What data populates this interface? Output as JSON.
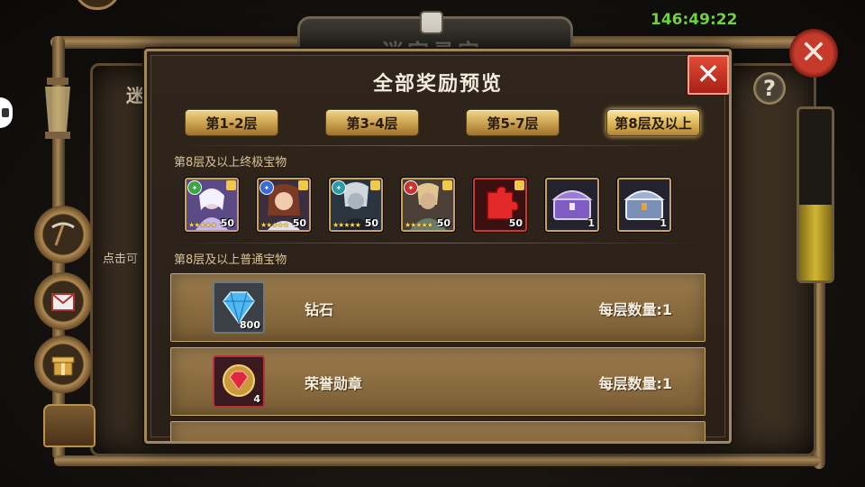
{
  "hud": {
    "timer": "146:49:22",
    "background_title": "迷宫寻宝",
    "side_hint": "点击可",
    "side_banner": "迷"
  },
  "modal": {
    "title": "全部奖励预览",
    "close_label": "✕",
    "tabs": [
      {
        "label": "第1-2层"
      },
      {
        "label": "第3-4层"
      },
      {
        "label": "第5-7层"
      },
      {
        "label": "第8层及以上",
        "active": true
      }
    ],
    "ultimate_section_label": "第8层及以上终极宝物",
    "ultimate_items": [
      {
        "name": "hero-shard-1",
        "count": "50",
        "stars": "★★★★★",
        "element_color": "#3aa545"
      },
      {
        "name": "hero-shard-2",
        "count": "50",
        "stars": "★★★★★",
        "element_color": "#3a6ad8"
      },
      {
        "name": "hero-shard-3",
        "count": "50",
        "stars": "★★★★★",
        "element_color": "#2a9aa8"
      },
      {
        "name": "hero-shard-4",
        "count": "50",
        "stars": "★★★★★",
        "element_color": "#c83434"
      },
      {
        "name": "red-puzzle-piece",
        "count": "50"
      },
      {
        "name": "purple-chest",
        "count": "1"
      },
      {
        "name": "silver-chest",
        "count": "1"
      }
    ],
    "normal_section_label": "第8层及以上普通宝物",
    "normal_items": [
      {
        "name": "钻石",
        "icon": "diamond-icon",
        "count": "800",
        "qty": "每层数量:1"
      },
      {
        "name": "荣誉勋章",
        "icon": "honor-medal-icon",
        "count": "4",
        "qty": "每层数量:1"
      }
    ]
  },
  "colors": {
    "accent_gold": "#caa454",
    "close_red": "#d83a28",
    "timer_green": "#6fd73a"
  }
}
